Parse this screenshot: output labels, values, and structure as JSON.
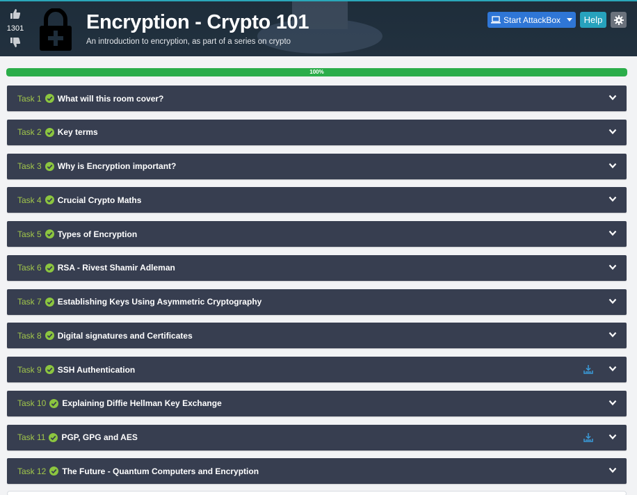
{
  "header": {
    "title": "Encryption - Crypto 101",
    "subtitle": "An introduction to encryption, as part of a series on crypto",
    "votes": "1301",
    "icons": {
      "upvote": "thumbs-up-icon",
      "downvote": "thumbs-down-icon",
      "room": "padlock-plus-icon"
    }
  },
  "toolbar": {
    "attackbox_label": "Start AttackBox",
    "help_label": "Help",
    "colors": {
      "attackbox": "#2f76d6",
      "help": "#27a2bd",
      "settings": "#6b727c"
    }
  },
  "progress": {
    "percent_label": "100%",
    "value": 1.0,
    "color": "#2bad4a"
  },
  "tasks": [
    {
      "number": "Task 1",
      "title": "What will this room cover?",
      "has_download": false
    },
    {
      "number": "Task 2",
      "title": "Key terms",
      "has_download": false
    },
    {
      "number": "Task 3",
      "title": "Why is Encryption important?",
      "has_download": false
    },
    {
      "number": "Task 4",
      "title": "Crucial Crypto Maths",
      "has_download": false
    },
    {
      "number": "Task 5",
      "title": "Types of Encryption",
      "has_download": false
    },
    {
      "number": "Task 6",
      "title": "RSA - Rivest Shamir Adleman",
      "has_download": false
    },
    {
      "number": "Task 7",
      "title": "Establishing Keys Using Asymmetric Cryptography",
      "has_download": false
    },
    {
      "number": "Task 8",
      "title": "Digital signatures and Certificates",
      "has_download": false
    },
    {
      "number": "Task 9",
      "title": "SSH Authentication",
      "has_download": true
    },
    {
      "number": "Task 10",
      "title": "Explaining Diffie Hellman Key Exchange",
      "has_download": false
    },
    {
      "number": "Task 11",
      "title": "PGP, GPG and AES",
      "has_download": true
    },
    {
      "number": "Task 12",
      "title": "The Future - Quantum Computers and Encryption",
      "has_download": false
    }
  ],
  "colors": {
    "task_bg": "#373e50",
    "task_number": "#a2c74a",
    "check": "#8cc63f",
    "download": "#3a9bd9"
  }
}
